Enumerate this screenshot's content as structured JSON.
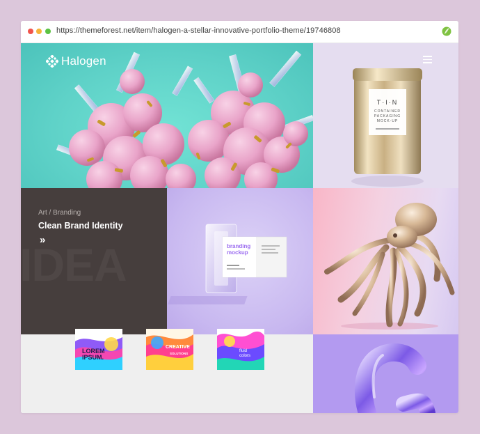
{
  "browser": {
    "url": "https://themeforest.net/item/halogen-a-stellar-innovative-portfolio-theme/19746808",
    "dots": [
      "#f1544b",
      "#f6b43a",
      "#5cc343"
    ]
  },
  "site": {
    "logo_text": "Halogen",
    "accent": "#5fd2c8"
  },
  "tin": {
    "brand": "T·I·N",
    "line1": "CONTAINER",
    "line2": "PACKAGING",
    "line3": "MOCK-UP"
  },
  "portfolio": {
    "featured": {
      "category": "Art / Branding",
      "title": "Clean Brand Identity",
      "arrow": "»",
      "bg_word": "IDEA"
    },
    "card": {
      "heading1": "branding",
      "heading2": "mockup"
    },
    "posters": [
      {
        "text1": "LOREM",
        "text2": "IPSUM."
      },
      {
        "text1": "CREATIVE",
        "text2": "SOLUTIONS"
      },
      {
        "text1": "fluid",
        "text2": "colors"
      }
    ]
  }
}
